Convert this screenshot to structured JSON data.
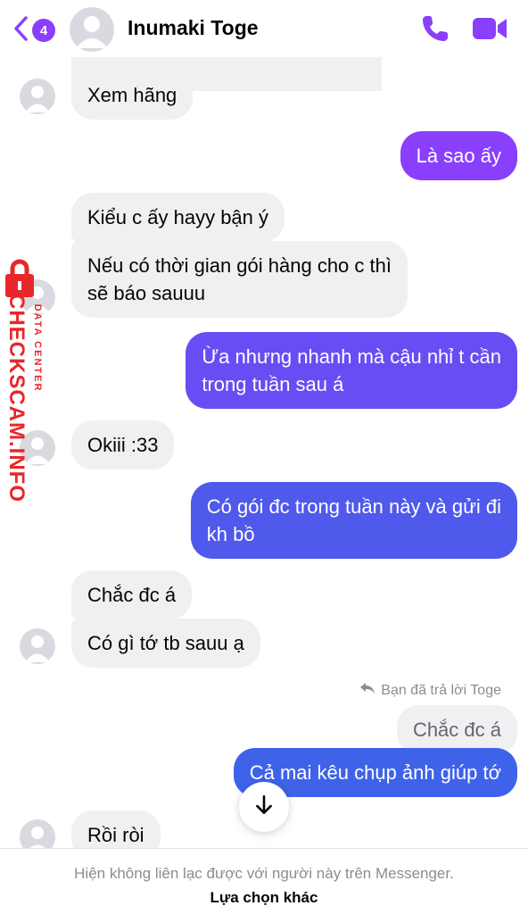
{
  "header": {
    "unread_count": "4",
    "contact_name": "Inumaki Toge",
    "accent": "#8a3ffc"
  },
  "icons": {
    "back": "chevron-left-icon",
    "call": "phone-icon",
    "video": "video-camera-icon",
    "scroll": "arrow-down-icon",
    "reply": "reply-arrow-icon"
  },
  "messages": [
    {
      "side": "in",
      "text": "Xem hãng"
    },
    {
      "side": "out",
      "text": "Là sao ấy"
    },
    {
      "side": "in",
      "text": "Kiểu c ấy hayy bận ý"
    },
    {
      "side": "in",
      "lines": [
        "Nếu có thời gian gói hàng cho c thì",
        "sẽ báo sauuu"
      ]
    },
    {
      "side": "out",
      "lines": [
        "Ừa nhưng nhanh mà cậu nhỉ t cần",
        "trong tuần sau á"
      ]
    },
    {
      "side": "in",
      "text": "Okiii :33"
    },
    {
      "side": "out",
      "lines": [
        "Có gói đc trong tuần này và gửi đi",
        "kh bồ"
      ]
    },
    {
      "side": "in",
      "text": "Chắc đc á"
    },
    {
      "side": "in",
      "text": "Có gì tớ tb sauu ạ"
    },
    {
      "side": "out",
      "text": "Cả mai kêu chụp ảnh giúp tớ"
    },
    {
      "side": "in",
      "text": "Rồi ròi"
    }
  ],
  "reply_context": {
    "note": "Bạn đã trả lời Toge",
    "quoted_text": "Chắc đc á"
  },
  "footer": {
    "notice": "Hiện không liên lạc được với người này trên Messenger.",
    "action": "Lựa chọn khác"
  },
  "watermark": {
    "small": "DATA CENTER",
    "big": "CHECKSCAM.INFO",
    "color": "#e8272b"
  }
}
